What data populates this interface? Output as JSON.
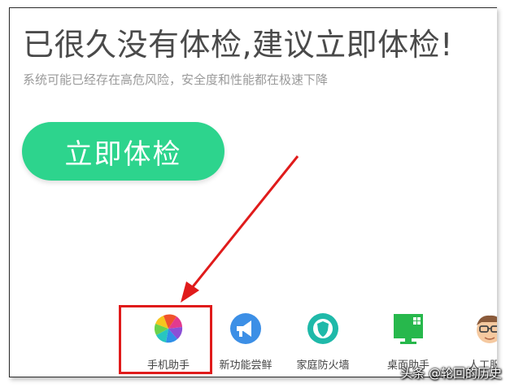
{
  "header": {
    "headline": "已很久没有体检,建议立即体检!",
    "subline": "系统可能已经存在高危风险，安全度和性能都在极速下降"
  },
  "check_button": {
    "label": "立即体检",
    "color": "#2dd48d"
  },
  "tools": [
    {
      "label": "手机助手",
      "icon": "colorful-pinwheel-icon"
    },
    {
      "label": "新功能尝鲜",
      "icon": "megaphone-icon"
    },
    {
      "label": "家庭防火墙",
      "icon": "shield-icon"
    },
    {
      "label": "桌面助手",
      "icon": "monitor-icon"
    },
    {
      "label": "人工服务",
      "icon": "support-agent-icon"
    }
  ],
  "watermark": "头条 @轮回的历史",
  "annotation_color": "#e01b1b"
}
